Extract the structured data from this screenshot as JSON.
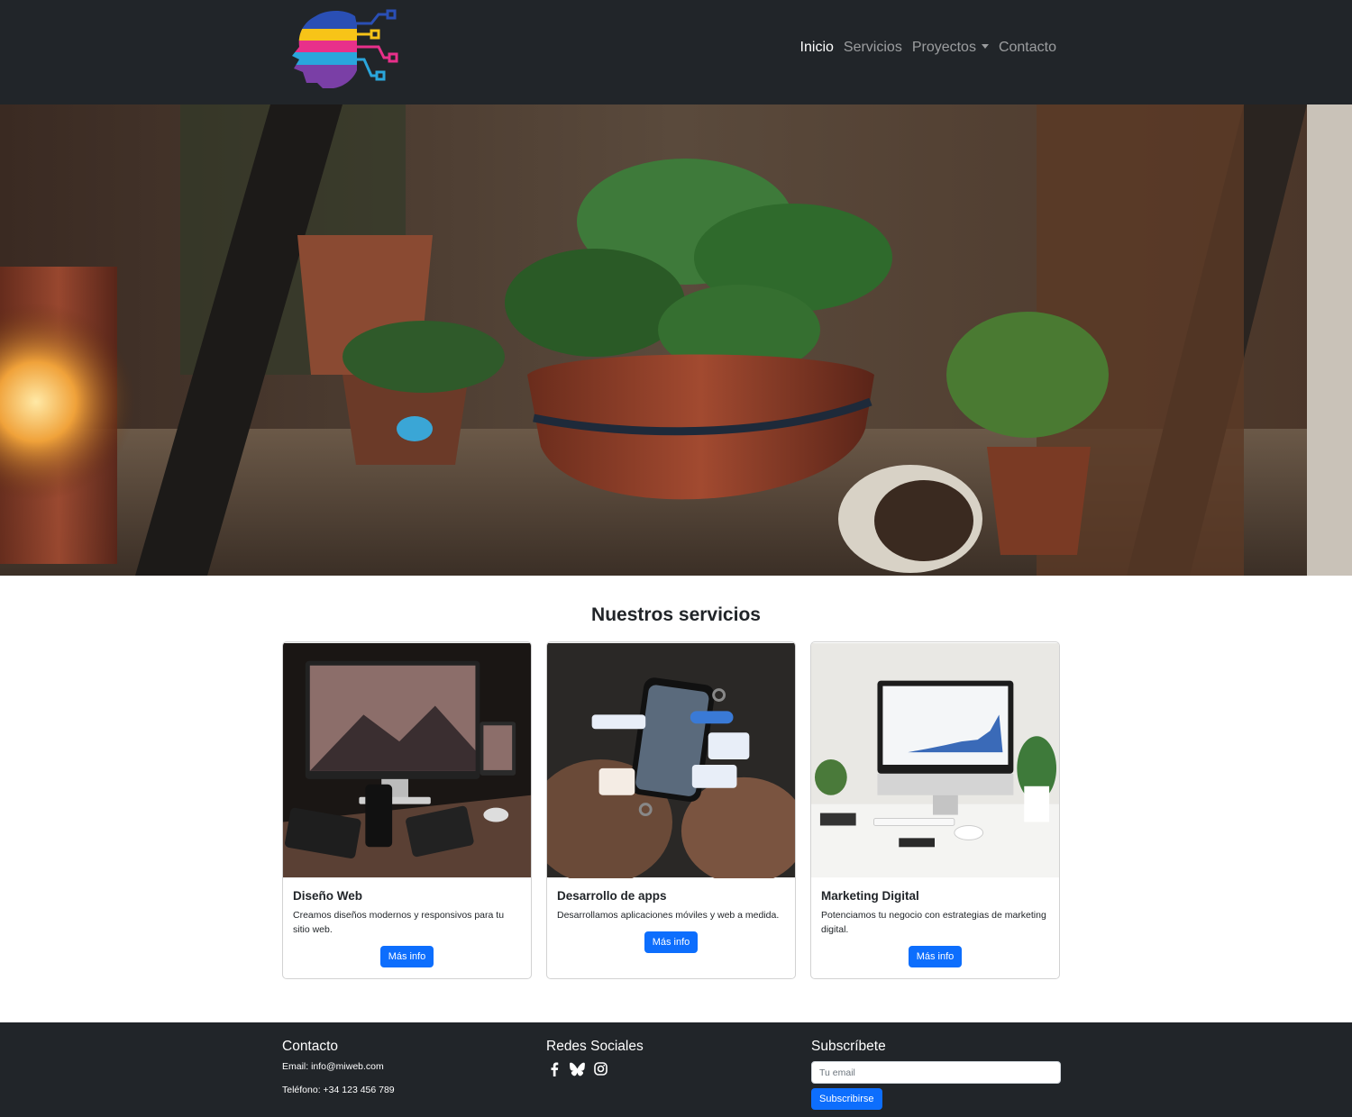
{
  "nav": {
    "logo_icon": "head-circuit-logo",
    "items": [
      {
        "label": "Inicio",
        "active": true
      },
      {
        "label": "Servicios",
        "active": false
      },
      {
        "label": "Proyectos",
        "active": false,
        "dropdown": true
      },
      {
        "label": "Contacto",
        "active": false
      }
    ]
  },
  "hero": {
    "image": "potted-plants-photo"
  },
  "services": {
    "title": "Nuestros servicios",
    "cards": [
      {
        "image": "devices-mockup-photo",
        "title": "Diseño Web",
        "text": "Creamos diseños modernos y responsivos para tu sitio web.",
        "button": "Más info"
      },
      {
        "image": "phone-app-photo",
        "title": "Desarrollo de apps",
        "text": "Desarrollamos aplicaciones móviles y web a medida.",
        "button": "Más info"
      },
      {
        "image": "desk-analytics-photo",
        "title": "Marketing Digital",
        "text": "Potenciamos tu negocio con estrategias de marketing digital.",
        "button": "Más info"
      }
    ]
  },
  "footer": {
    "contact": {
      "title": "Contacto",
      "email": "Email: info@miweb.com",
      "phone": "Teléfono: +34 123 456 789"
    },
    "social": {
      "title": "Redes Sociales",
      "icons": [
        "facebook-icon",
        "bluesky-icon",
        "instagram-icon"
      ]
    },
    "subscribe": {
      "title": "Subscríbete",
      "placeholder": "Tu email",
      "button": "Subscribirse"
    }
  },
  "colors": {
    "navbar": "#212529",
    "primary": "#0d6efd",
    "footer": "#212529"
  }
}
